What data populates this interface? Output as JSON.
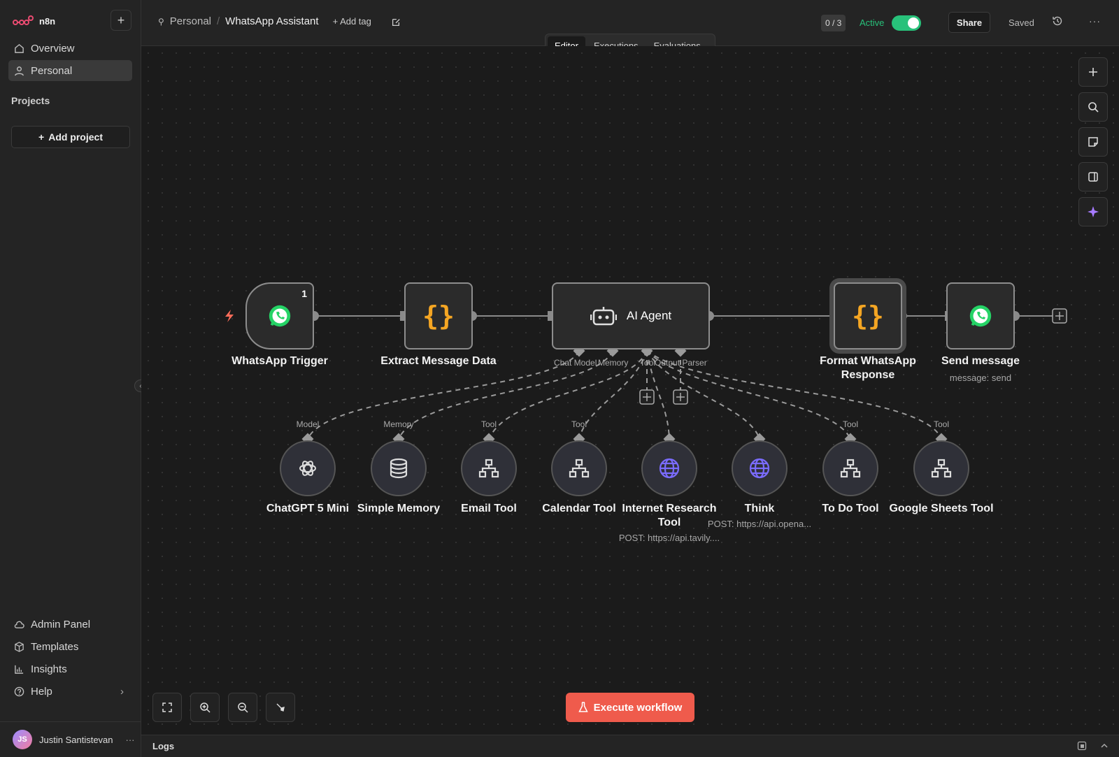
{
  "app": {
    "name": "n8n"
  },
  "sidebar": {
    "nav": [
      {
        "label": "Overview",
        "icon": "home-icon"
      },
      {
        "label": "Personal",
        "icon": "user-icon"
      }
    ],
    "projects_heading": "Projects",
    "add_project": "Add project",
    "bottom": [
      {
        "label": "Admin Panel",
        "icon": "cloud-icon"
      },
      {
        "label": "Templates",
        "icon": "box-icon"
      },
      {
        "label": "Insights",
        "icon": "chart-icon"
      },
      {
        "label": "Help",
        "icon": "help-icon"
      }
    ],
    "user": {
      "initials": "JS",
      "name": "Justin Santistevan"
    }
  },
  "header": {
    "breadcrumb_project": "Personal",
    "workflow_title": "WhatsApp Assistant",
    "add_tag": "+ Add tag",
    "counter": "0 / 3",
    "active_label": "Active",
    "share": "Share",
    "saved": "Saved"
  },
  "tabs": [
    {
      "label": "Editor",
      "selected": true
    },
    {
      "label": "Executions",
      "selected": false
    },
    {
      "label": "Evaluations",
      "selected": false
    }
  ],
  "nodes": {
    "trigger": {
      "label": "WhatsApp Trigger",
      "badge": "1"
    },
    "extract": {
      "label": "Extract Message Data"
    },
    "agent": {
      "label": "AI Agent",
      "ports": [
        "Chat Model",
        "Memory",
        "Tool",
        "Output Parser"
      ]
    },
    "format": {
      "label": "Format WhatsApp Response"
    },
    "send": {
      "label": "Send message",
      "subtitle": "message: send"
    }
  },
  "sub_nodes": [
    {
      "label": "ChatGPT 5 Mini",
      "port": "Model",
      "icon": "openai-icon",
      "sub": ""
    },
    {
      "label": "Simple Memory",
      "port": "Memory",
      "icon": "database-icon",
      "sub": ""
    },
    {
      "label": "Email Tool",
      "port": "Tool",
      "icon": "workflow-icon",
      "sub": ""
    },
    {
      "label": "Calendar Tool",
      "port": "Tool",
      "icon": "workflow-icon",
      "sub": ""
    },
    {
      "label": "Internet Research Tool",
      "port": "",
      "icon": "globe-icon",
      "sub": "POST: https://api.tavily...."
    },
    {
      "label": "Think",
      "port": "",
      "icon": "globe-icon",
      "sub": "POST: https://api.opena..."
    },
    {
      "label": "To Do Tool",
      "port": "Tool",
      "icon": "workflow-icon",
      "sub": ""
    },
    {
      "label": "Google Sheets Tool",
      "port": "Tool",
      "icon": "workflow-icon",
      "sub": ""
    }
  ],
  "execute": "Execute workflow",
  "logs": "Logs",
  "colors": {
    "accent": "#ef5b4c",
    "active": "#28c17a",
    "whatsapp": "#25d366",
    "code": "#f5a623",
    "globe": "#7b6cff"
  }
}
